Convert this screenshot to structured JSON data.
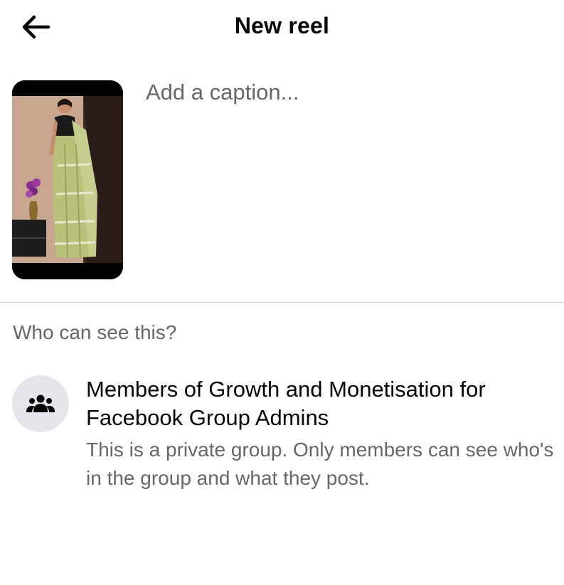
{
  "header": {
    "title": "New reel",
    "back_icon": "arrow-left-icon"
  },
  "composer": {
    "thumbnail_description": "reel-video-thumbnail",
    "caption_placeholder": "Add a caption...",
    "caption_value": ""
  },
  "audience": {
    "section_label": "Who can see this?",
    "icon": "group-people-icon",
    "title": "Members of Growth and Monetisation for Facebook Group Admins",
    "description": "This is a private group. Only members can see who's in the group and what they post."
  },
  "colors": {
    "text_primary": "#050505",
    "text_secondary": "#65676b",
    "divider": "#ced0d4",
    "icon_bg": "#e4e6eb"
  }
}
